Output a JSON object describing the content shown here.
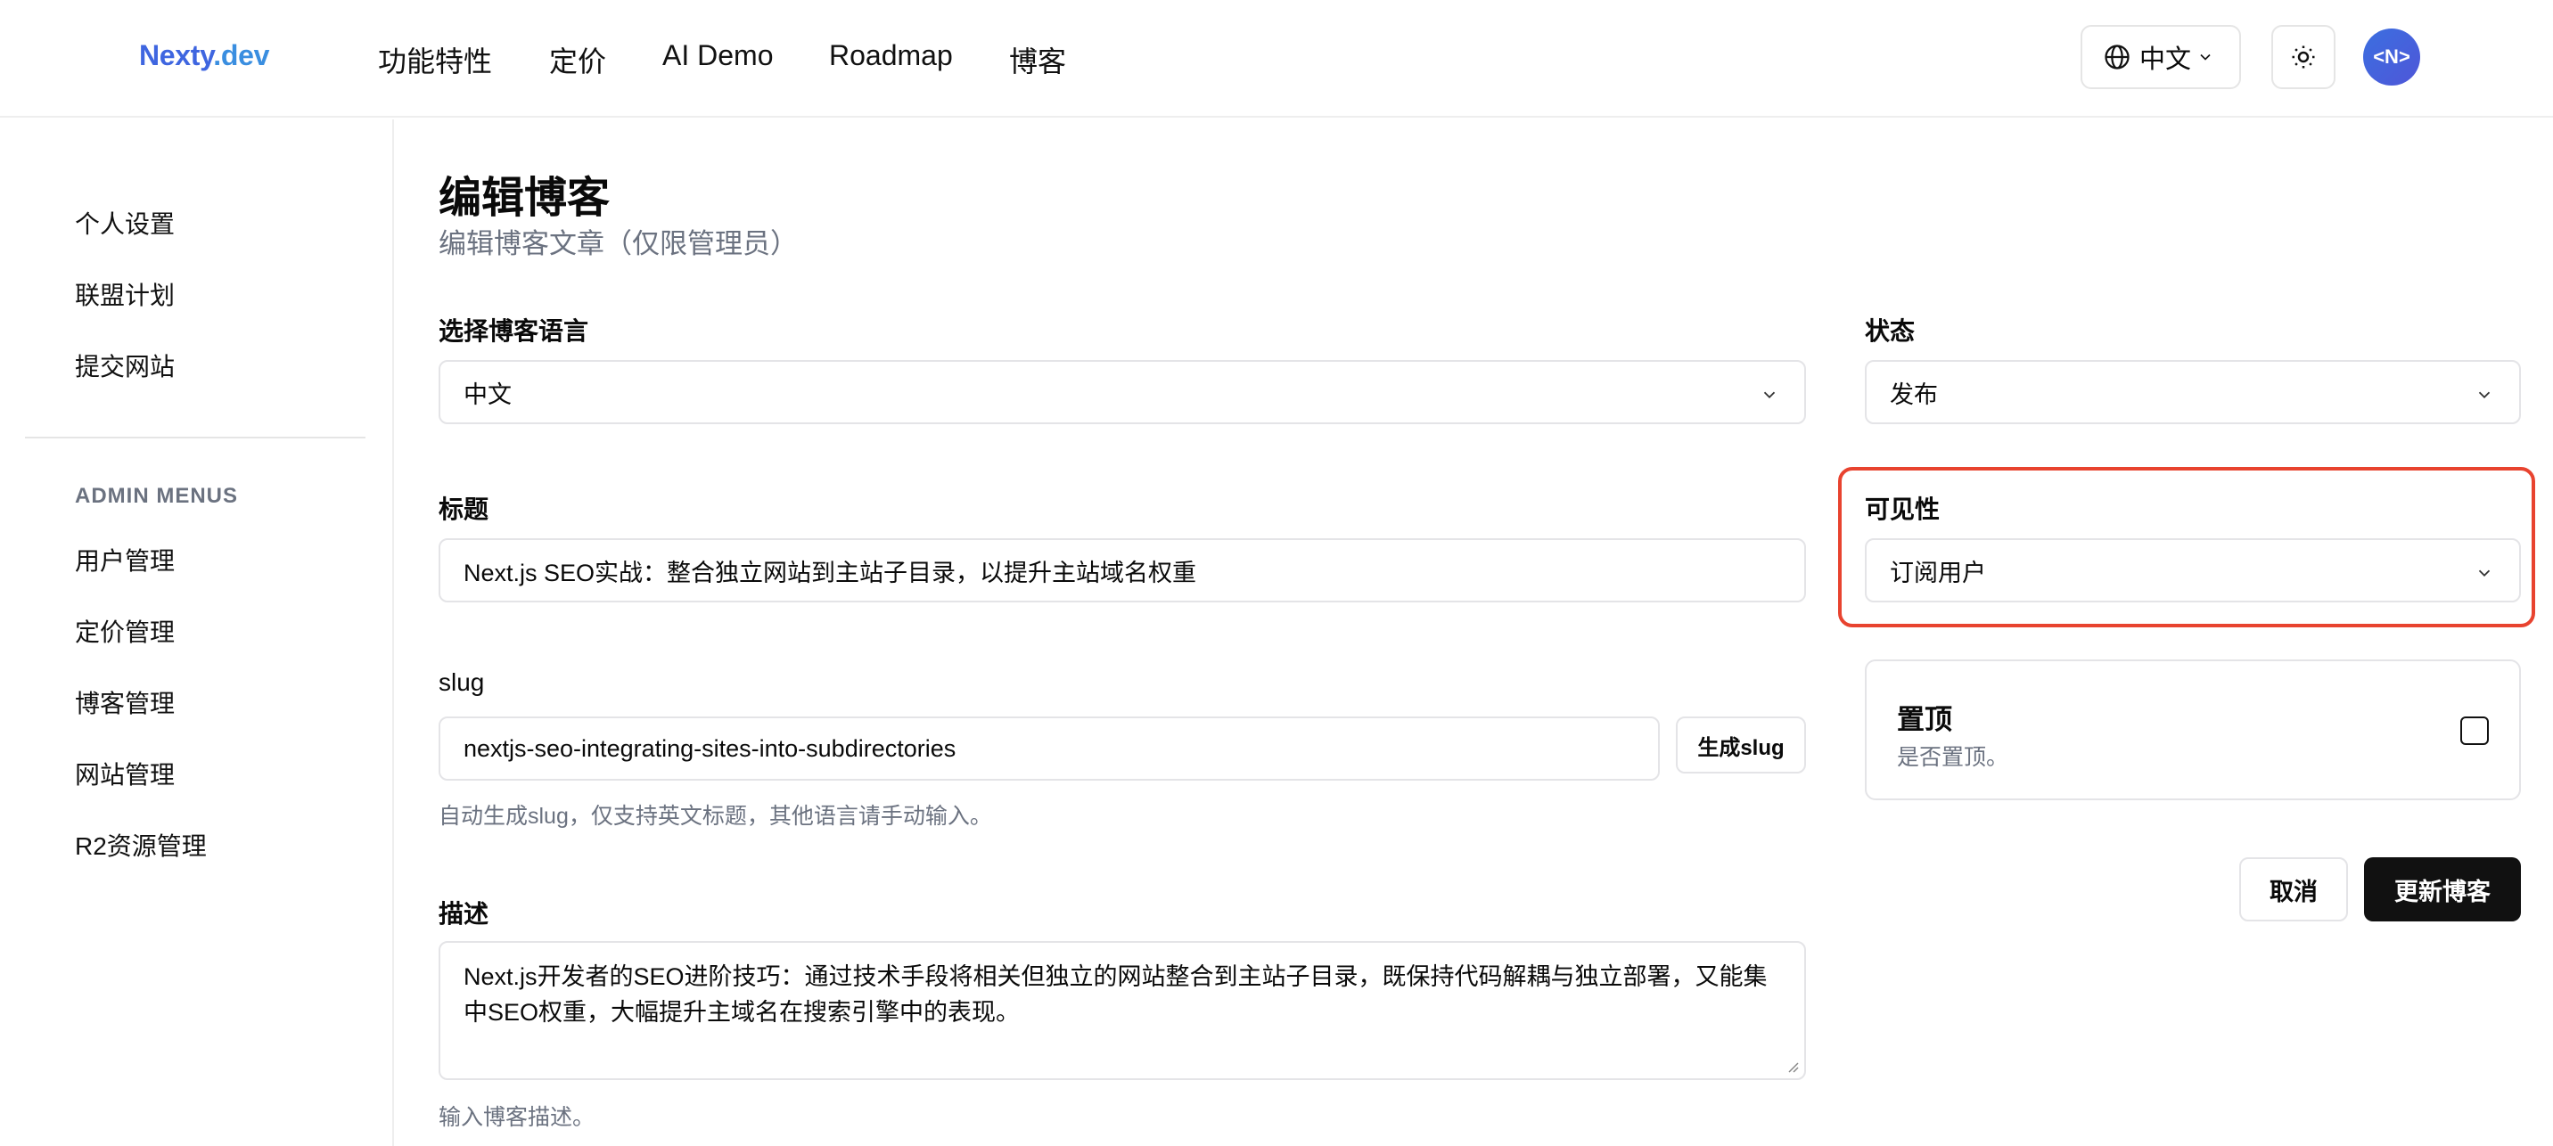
{
  "header": {
    "logo_part1": "Nexty",
    "logo_part2": ".dev",
    "nav": [
      "功能特性",
      "定价",
      "AI Demo",
      "Roadmap",
      "博客"
    ],
    "language": "中文",
    "avatar_text": "<N>",
    "globe_icon": "globe-icon",
    "theme_icon": "sun-icon"
  },
  "sidebar": {
    "items": [
      "个人设置",
      "联盟计划",
      "提交网站"
    ],
    "section_title": "ADMIN MENUS",
    "admin_items": [
      "用户管理",
      "定价管理",
      "博客管理",
      "网站管理",
      "R2资源管理"
    ]
  },
  "page": {
    "title": "编辑博客",
    "subtitle": "编辑博客文章（仅限管理员）"
  },
  "form": {
    "language_label": "选择博客语言",
    "language_value": "中文",
    "status_label": "状态",
    "status_value": "发布",
    "title_label": "标题",
    "title_value": "Next.js SEO实战：整合独立网站到主站子目录，以提升主站域名权重",
    "visibility_label": "可见性",
    "visibility_value": "订阅用户",
    "slug_label": "slug",
    "slug_value": "nextjs-seo-integrating-sites-into-subdirectories",
    "generate_slug_label": "生成slug",
    "slug_hint": "自动生成slug，仅支持英文标题，其他语言请手动输入。",
    "pin_title": "置顶",
    "pin_desc": "是否置顶。",
    "pin_checked": false,
    "description_label": "描述",
    "description_value": "Next.js开发者的SEO进阶技巧：通过技术手段将相关但独立的网站整合到主站子目录，既保持代码解耦与独立部署，又能集中SEO权重，大幅提升主域名在搜索引擎中的表现。",
    "description_hint": "输入博客描述。",
    "cancel_label": "取消",
    "update_label": "更新博客"
  },
  "colors": {
    "highlight": "#e8432f",
    "primary_button": "#111111",
    "logo_blue": "#3f66e0"
  }
}
